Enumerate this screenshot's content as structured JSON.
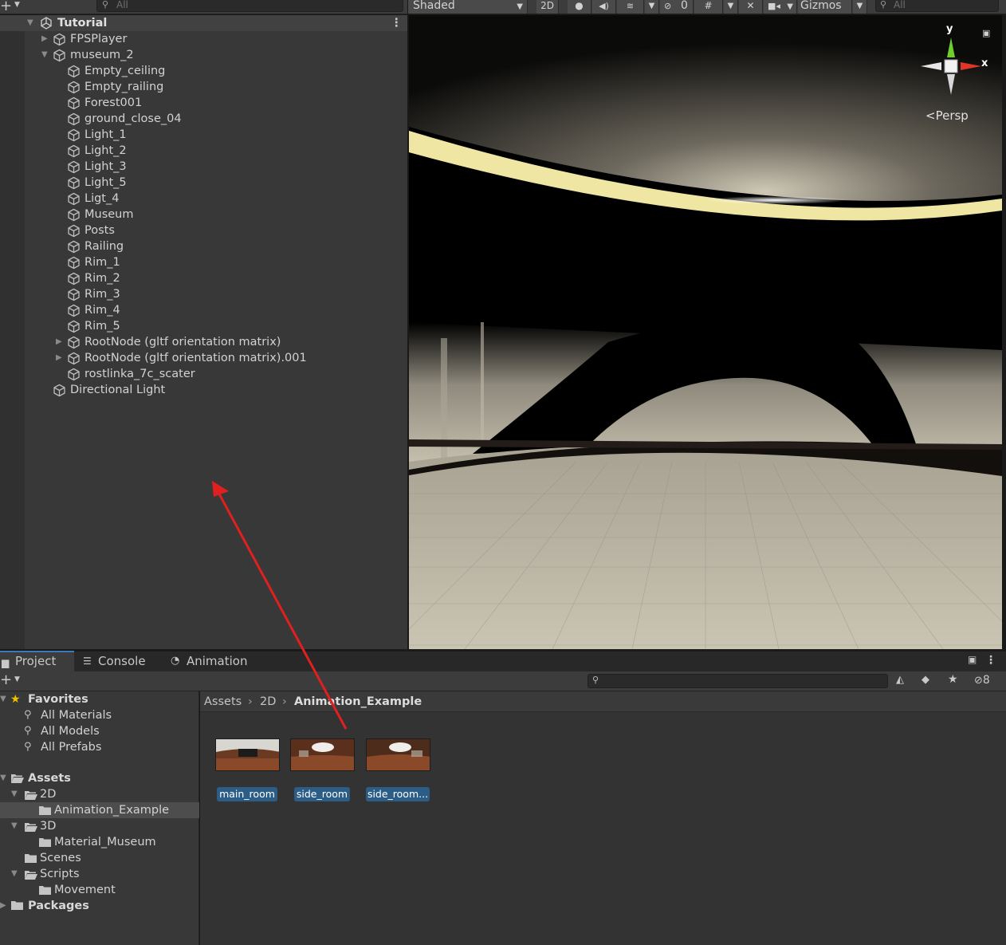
{
  "hierarchy": {
    "search_placeholder": "All",
    "scene_name": "Tutorial",
    "items": [
      {
        "label": "FPSPlayer",
        "depth": 1,
        "fold": "collapsed"
      },
      {
        "label": "museum_2",
        "depth": 1,
        "fold": "expanded"
      },
      {
        "label": "Empty_ceiling",
        "depth": 2,
        "fold": "none"
      },
      {
        "label": "Empty_railing",
        "depth": 2,
        "fold": "none"
      },
      {
        "label": "Forest001",
        "depth": 2,
        "fold": "none"
      },
      {
        "label": "ground_close_04",
        "depth": 2,
        "fold": "none"
      },
      {
        "label": "Light_1",
        "depth": 2,
        "fold": "none"
      },
      {
        "label": "Light_2",
        "depth": 2,
        "fold": "none"
      },
      {
        "label": "Light_3",
        "depth": 2,
        "fold": "none"
      },
      {
        "label": "Light_5",
        "depth": 2,
        "fold": "none"
      },
      {
        "label": "Ligt_4",
        "depth": 2,
        "fold": "none"
      },
      {
        "label": "Museum",
        "depth": 2,
        "fold": "none"
      },
      {
        "label": "Posts",
        "depth": 2,
        "fold": "none"
      },
      {
        "label": "Railing",
        "depth": 2,
        "fold": "none"
      },
      {
        "label": "Rim_1",
        "depth": 2,
        "fold": "none"
      },
      {
        "label": "Rim_2",
        "depth": 2,
        "fold": "none"
      },
      {
        "label": "Rim_3",
        "depth": 2,
        "fold": "none"
      },
      {
        "label": "Rim_4",
        "depth": 2,
        "fold": "none"
      },
      {
        "label": "Rim_5",
        "depth": 2,
        "fold": "none"
      },
      {
        "label": "RootNode (gltf orientation matrix)",
        "depth": 2,
        "fold": "collapsed"
      },
      {
        "label": "RootNode (gltf orientation matrix).001",
        "depth": 2,
        "fold": "collapsed"
      },
      {
        "label": "rostlinka_7c_scater",
        "depth": 2,
        "fold": "none"
      },
      {
        "label": "Directional Light",
        "depth": 1,
        "fold": "none"
      }
    ]
  },
  "scene_toolbar": {
    "shading_mode": "Shaded",
    "toggle_2d": "2D",
    "hidden_count": "0",
    "gizmos_label": "Gizmos",
    "search_placeholder": "All"
  },
  "scene_gizmo": {
    "axis_y": "y",
    "axis_x": "x",
    "projection_label": "Persp"
  },
  "bottom_tabs": [
    {
      "label": "Project",
      "icon": "folder-icon",
      "active": true
    },
    {
      "label": "Console",
      "icon": "console-icon",
      "active": false
    },
    {
      "label": "Animation",
      "icon": "clock-icon",
      "active": false
    }
  ],
  "project": {
    "hidden_count": "8",
    "favorites": {
      "label": "Favorites",
      "items": [
        "All Materials",
        "All Models",
        "All Prefabs"
      ]
    },
    "assets_tree": {
      "root": "Assets",
      "items": [
        {
          "label": "2D",
          "depth": 1,
          "fold": "expanded"
        },
        {
          "label": "Animation_Example",
          "depth": 2,
          "fold": "none",
          "selected": true
        },
        {
          "label": "3D",
          "depth": 1,
          "fold": "expanded"
        },
        {
          "label": "Material_Museum",
          "depth": 2,
          "fold": "none"
        },
        {
          "label": "Scenes",
          "depth": 1,
          "fold": "none"
        },
        {
          "label": "Scripts",
          "depth": 1,
          "fold": "expanded"
        },
        {
          "label": "Movement",
          "depth": 2,
          "fold": "none"
        }
      ],
      "packages": "Packages"
    },
    "breadcrumb": [
      "Assets",
      "2D",
      "Animation_Example"
    ],
    "assets": [
      {
        "label": "main_room"
      },
      {
        "label": "side_room"
      },
      {
        "label": "side_room..."
      }
    ]
  },
  "colors": {
    "annotation_arrow": "#e02020",
    "selection_label": "#2c5d87",
    "active_tab_accent": "#3a79bb",
    "axis_x": "#e0362a",
    "axis_y": "#6fce2e"
  }
}
